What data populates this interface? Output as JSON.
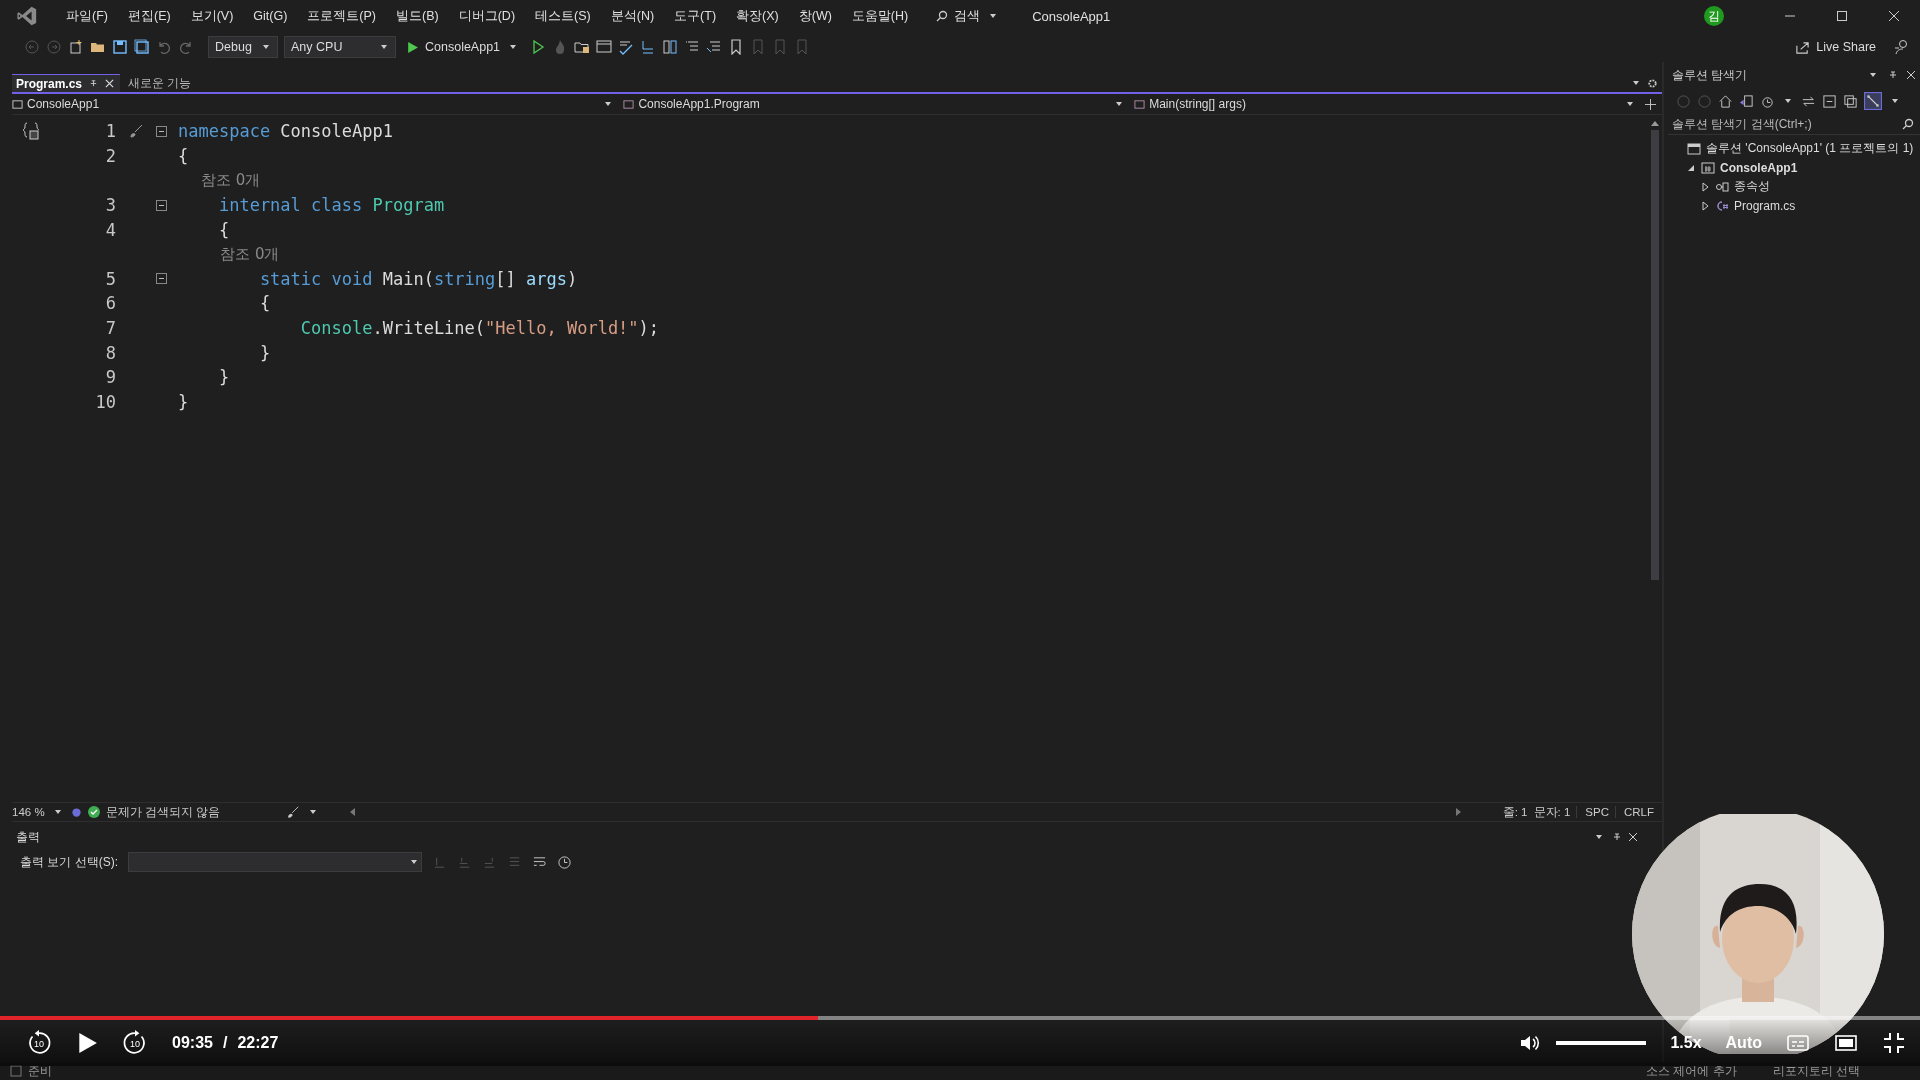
{
  "window": {
    "title": "ConsoleApp1",
    "account_initial": "김"
  },
  "menu": [
    "파일(F)",
    "편집(E)",
    "보기(V)",
    "Git(G)",
    "프로젝트(P)",
    "빌드(B)",
    "디버그(D)",
    "테스트(S)",
    "분석(N)",
    "도구(T)",
    "확장(X)",
    "창(W)",
    "도움말(H)"
  ],
  "search": {
    "label": "검색"
  },
  "toolbar": {
    "configuration": "Debug",
    "platform": "Any CPU",
    "run_target": "ConsoleApp1",
    "live_share": "Live Share"
  },
  "tabs": [
    {
      "label": "Program.cs",
      "selected": true
    },
    {
      "label": "새로운 기능",
      "selected": false
    }
  ],
  "nav_bar": [
    "ConsoleApp1",
    "ConsoleApp1.Program",
    "Main(string[] args)"
  ],
  "code": [
    {
      "kind": "code",
      "number": "1",
      "fold": true,
      "tokens": [
        {
          "kind": "keyword",
          "text": "namespace"
        },
        {
          "kind": "plain",
          "text": " ConsoleApp1"
        }
      ]
    },
    {
      "kind": "code",
      "number": "2",
      "tokens": [
        {
          "kind": "plain",
          "text": "{"
        }
      ]
    },
    {
      "kind": "codelens",
      "text": "    참조 0개"
    },
    {
      "kind": "code",
      "number": "3",
      "fold": true,
      "tokens": [
        {
          "kind": "keyword",
          "text": "    internal class "
        },
        {
          "kind": "type",
          "text": "Program"
        }
      ]
    },
    {
      "kind": "code",
      "number": "4",
      "tokens": [
        {
          "kind": "plain",
          "text": "    {"
        }
      ]
    },
    {
      "kind": "codelens",
      "text": "        참조 0개"
    },
    {
      "kind": "code",
      "number": "5",
      "fold": true,
      "tokens": [
        {
          "kind": "keyword",
          "text": "        static void"
        },
        {
          "kind": "plain",
          "text": " Main("
        },
        {
          "kind": "keyword",
          "text": "string"
        },
        {
          "kind": "plain",
          "text": "[] "
        },
        {
          "kind": "param",
          "text": "args"
        },
        {
          "kind": "plain",
          "text": ")"
        }
      ]
    },
    {
      "kind": "code",
      "number": "6",
      "tokens": [
        {
          "kind": "plain",
          "text": "        {"
        }
      ]
    },
    {
      "kind": "code",
      "number": "7",
      "tokens": [
        {
          "kind": "type",
          "text": "            Console"
        },
        {
          "kind": "plain",
          "text": ".WriteLine("
        },
        {
          "kind": "string",
          "text": "\"Hello, World!\""
        },
        {
          "kind": "plain",
          "text": ");"
        }
      ]
    },
    {
      "kind": "code",
      "number": "8",
      "tokens": [
        {
          "kind": "plain",
          "text": "        }"
        }
      ]
    },
    {
      "kind": "code",
      "number": "9",
      "tokens": [
        {
          "kind": "plain",
          "text": "    }"
        }
      ]
    },
    {
      "kind": "code",
      "number": "10",
      "tokens": [
        {
          "kind": "plain",
          "text": "}"
        }
      ]
    }
  ],
  "editor_status": {
    "zoom": "146 %",
    "issues": "문제가 검색되지 않음",
    "line": "줄: 1",
    "column": "문자: 1",
    "whitespace": "SPC",
    "line_ending": "CRLF"
  },
  "output": {
    "title": "출력",
    "source_label": "출력 보기 선택(S):"
  },
  "solution_explorer": {
    "title": "솔루션 탐색기",
    "search_placeholder": "솔루션 탐색기 검색(Ctrl+;)",
    "tree": [
      {
        "label": "솔루션 'ConsoleApp1' (1 프로젝트의 1)",
        "kind": "solution",
        "children": [
          {
            "label": "ConsoleApp1",
            "kind": "project",
            "expanded": true,
            "children": [
              {
                "label": "종속성",
                "kind": "dependencies",
                "expanded": false
              },
              {
                "label": "Program.cs",
                "kind": "csharp",
                "expanded": false
              }
            ]
          }
        ]
      }
    ]
  },
  "status_bar": {
    "ready": "준비",
    "source_control": "소스 제어에 추가",
    "repository": "리포지토리 선택"
  },
  "player": {
    "progress": {
      "level": 0.426
    },
    "rewind_seconds": "10",
    "forward_seconds": "10",
    "current_time": "09:35",
    "separator": "/",
    "duration": "22:27",
    "volume": {
      "level": 1
    },
    "speed": "1.5x",
    "quality": "Auto"
  },
  "webcam": {
    "kind": "picture"
  }
}
